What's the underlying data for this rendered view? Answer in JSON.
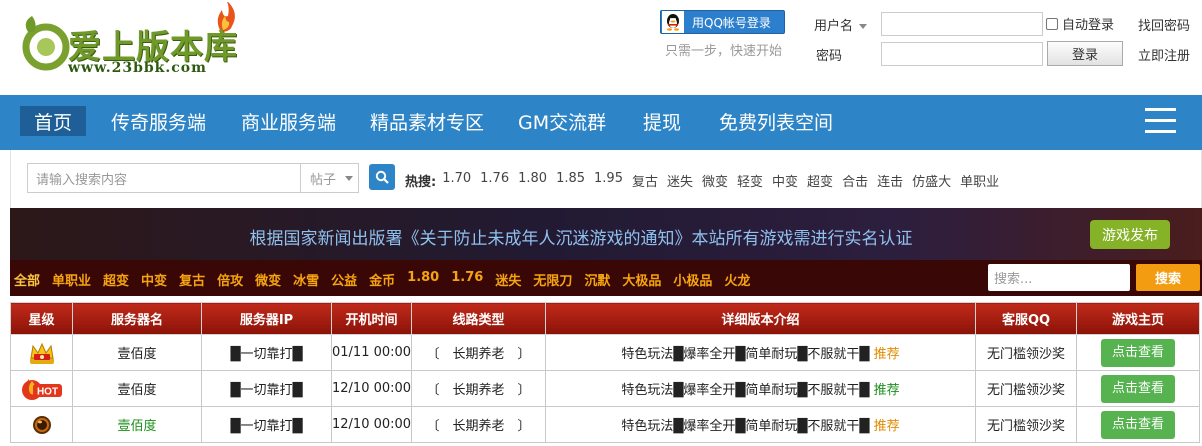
{
  "logo": {
    "name": "爱上版本库",
    "url": "www.23bbk.com"
  },
  "login": {
    "qq_button": "用QQ帐号登录",
    "qq_tip": "只需一步，快速开始",
    "username_label": "用户名",
    "password_label": "密码",
    "auto_login": "自动登录",
    "login_button": "登录",
    "find_password": "找回密码",
    "register": "立即注册"
  },
  "nav": {
    "items": [
      "首页",
      "传奇服务端",
      "商业服务端",
      "精品素材专区",
      "GM交流群",
      "提现",
      "免费列表空间"
    ],
    "active_index": 0
  },
  "search": {
    "placeholder": "请输入搜索内容",
    "type_selected": "帖子",
    "hot_label": "热搜:",
    "hot_keywords": [
      "1.70",
      "1.76",
      "1.80",
      "1.85",
      "1.95",
      "复古",
      "迷失",
      "微变",
      "轻变",
      "中变",
      "超变",
      "合击",
      "连击",
      "仿盛大",
      "单职业"
    ]
  },
  "notice": {
    "text": "根据国家新闻出版署《关于防止未成年人沉迷游戏的通知》本站所有游戏需进行实名认证",
    "publish_button": "游戏发布"
  },
  "filter": {
    "items": [
      "全部",
      "单职业",
      "超变",
      "中变",
      "复古",
      "倍攻",
      "微变",
      "冰雪",
      "公益",
      "金币",
      "1.80",
      "1.76",
      "迷失",
      "无限刀",
      "沉默",
      "大极品",
      "小极品",
      "火龙"
    ],
    "search_placeholder": "搜索...",
    "search_button": "搜索"
  },
  "table": {
    "headers": [
      "星级",
      "服务器名",
      "服务器IP",
      "开机时间",
      "线路类型",
      "详细版本介绍",
      "客服QQ",
      "游戏主页"
    ],
    "rows": [
      {
        "badge": "crown-icon",
        "name": "壹佰度",
        "name_color": "orange",
        "ip": "█一切靠打█",
        "time": "01/11 00:00",
        "line": "〔　长期养老　〕",
        "desc": "特色玩法█爆率全开█简单耐玩█不服就干█",
        "tag": "推荐",
        "tag_color": "orange",
        "qq": "无门槛领沙奖",
        "action": "点击查看"
      },
      {
        "badge": "hot-icon",
        "name": "壹佰度",
        "name_color": "orange",
        "ip": "█一切靠打█",
        "time": "12/10 00:00",
        "line": "〔　长期养老　〕",
        "desc": "特色玩法█爆率全开█简单耐玩█不服就干█",
        "tag": "推荐",
        "tag_color": "green",
        "qq": "无门槛领沙奖",
        "action": "点击查看"
      },
      {
        "badge": "orb-icon",
        "name": "壹佰度",
        "name_color": "green",
        "ip": "█一切靠打█",
        "time": "12/10 00:00",
        "line": "〔　长期养老　〕",
        "desc": "特色玩法█爆率全开█简单耐玩█不服就干█",
        "tag": "推荐",
        "tag_color": "orange",
        "qq": "无门槛领沙奖",
        "action": "点击查看"
      }
    ]
  },
  "colors": {
    "nav_bg": "#2d84c6",
    "nav_active": "#1d5f96",
    "table_header": "#a81c10",
    "filter_bg": "#3a0707",
    "view_button": "#56b350",
    "publish_button": "#86b228",
    "filter_button": "#f39c11",
    "time_red": "#e00000"
  }
}
